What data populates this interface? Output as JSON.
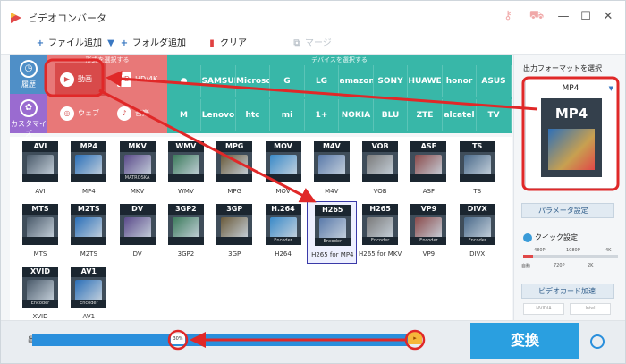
{
  "window": {
    "title": "ビデオコンバータ",
    "title_icons": [
      "key-icon",
      "cart-icon"
    ],
    "controls": [
      "minimize-icon",
      "maximize-icon",
      "close-icon"
    ]
  },
  "toolbar": {
    "add_file": "ファイル追加",
    "add_folder": "フォルダ追加",
    "clear": "クリア",
    "merge": "マージ"
  },
  "selector": {
    "history_label": "履歴",
    "custom_label": "カスタマイズ",
    "format_header": "形式を選択する",
    "device_header": "デバイスを選択する",
    "video_label": "動画",
    "hd_label": "HD/4K",
    "web_label": "ウェブ",
    "audio_label": "音楽",
    "devices_row1": [
      "",
      "SAMSUNG",
      "Microsoft",
      "G",
      "LG",
      "amazon",
      "SONY",
      "HUAWEI",
      "honor",
      "ASUS"
    ],
    "devices_row2": [
      "M",
      "Lenovo",
      "htc",
      "mi",
      "1+",
      "NOKIA",
      "BLU",
      "ZTE",
      "alcatel",
      "TV"
    ]
  },
  "formats": [
    {
      "badge": "AVI",
      "name": "AVI",
      "sub": ""
    },
    {
      "badge": "MP4",
      "name": "MP4",
      "sub": ""
    },
    {
      "badge": "MKV",
      "name": "MKV",
      "sub": "MATROSKA"
    },
    {
      "badge": "WMV",
      "name": "WMV",
      "sub": ""
    },
    {
      "badge": "MPG",
      "name": "MPG",
      "sub": ""
    },
    {
      "badge": "MOV",
      "name": "MOV",
      "sub": ""
    },
    {
      "badge": "M4V",
      "name": "M4V",
      "sub": ""
    },
    {
      "badge": "VOB",
      "name": "VOB",
      "sub": ""
    },
    {
      "badge": "ASF",
      "name": "ASF",
      "sub": ""
    },
    {
      "badge": "TS",
      "name": "TS",
      "sub": ""
    },
    {
      "badge": "MTS",
      "name": "MTS",
      "sub": ""
    },
    {
      "badge": "M2TS",
      "name": "M2TS",
      "sub": ""
    },
    {
      "badge": "DV",
      "name": "DV",
      "sub": ""
    },
    {
      "badge": "3GP2",
      "name": "3GP2",
      "sub": ""
    },
    {
      "badge": "3GP",
      "name": "3GP",
      "sub": ""
    },
    {
      "badge": "H.264",
      "name": "H264",
      "sub": "Encoder"
    },
    {
      "badge": "H265",
      "name": "H265 for MP4",
      "sub": "Encoder"
    },
    {
      "badge": "H265",
      "name": "H265 for MKV",
      "sub": "Encoder"
    },
    {
      "badge": "VP9",
      "name": "VP9",
      "sub": "Encoder"
    },
    {
      "badge": "DIVX",
      "name": "DIVX",
      "sub": "Encoder"
    },
    {
      "badge": "XVID",
      "name": "XVID",
      "sub": "Encoder"
    },
    {
      "badge": "AV1",
      "name": "AV1",
      "sub": "Encoder"
    }
  ],
  "sidebar": {
    "output_label": "出力フォーマットを選択",
    "selected_format": "MP4",
    "param_button": "パラメータ設定",
    "quick_label": "クイック設定",
    "quality_ticks_top": [
      "480P",
      "1080P",
      "4K"
    ],
    "quality_ticks_bottom": [
      "自動",
      "720P",
      "2K"
    ],
    "quality_level": 0.1,
    "gpu_button": "ビデオカード加速",
    "gpu_options": [
      "NVIDIA",
      "Intel"
    ]
  },
  "bottom": {
    "output_label": "出",
    "progress_percent": "30%",
    "convert_label": "変換"
  },
  "colors": {
    "accent_blue": "#2a9fe0",
    "annotation_red": "#e02828"
  }
}
